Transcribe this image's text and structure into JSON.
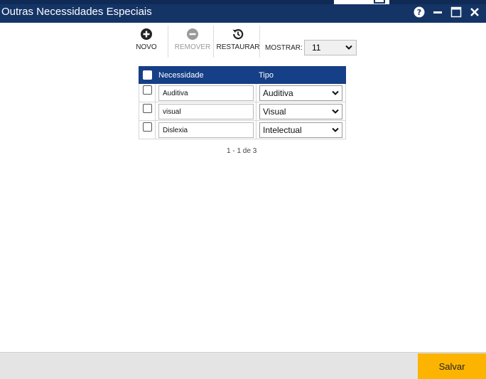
{
  "window": {
    "title": "Outras Necessidades Especiais",
    "controls": [
      "help-icon",
      "minimize-icon",
      "maximize-icon",
      "close-icon"
    ]
  },
  "toolbar": {
    "novo_label": "NOVO",
    "remover_label": "REMOVER",
    "restaurar_label": "RESTAURAR",
    "mostrar_label": "MOSTRAR:",
    "mostrar_value": "11"
  },
  "grid": {
    "columns": [
      "Necessidade",
      "Tipo"
    ],
    "rows": [
      {
        "necessidade": "Auditiva",
        "tipo": "Auditiva"
      },
      {
        "necessidade": "visual",
        "tipo": "Visual"
      },
      {
        "necessidade": "Dislexia",
        "tipo": "Intelectual"
      }
    ],
    "header_color": "#153f86"
  },
  "pager": {
    "text": "1 - 1 de 3"
  },
  "footer": {
    "save_label": "Salvar",
    "save_color": "#fcb400"
  },
  "colors": {
    "title_bar": "#143466",
    "accent": "#fcb400"
  }
}
